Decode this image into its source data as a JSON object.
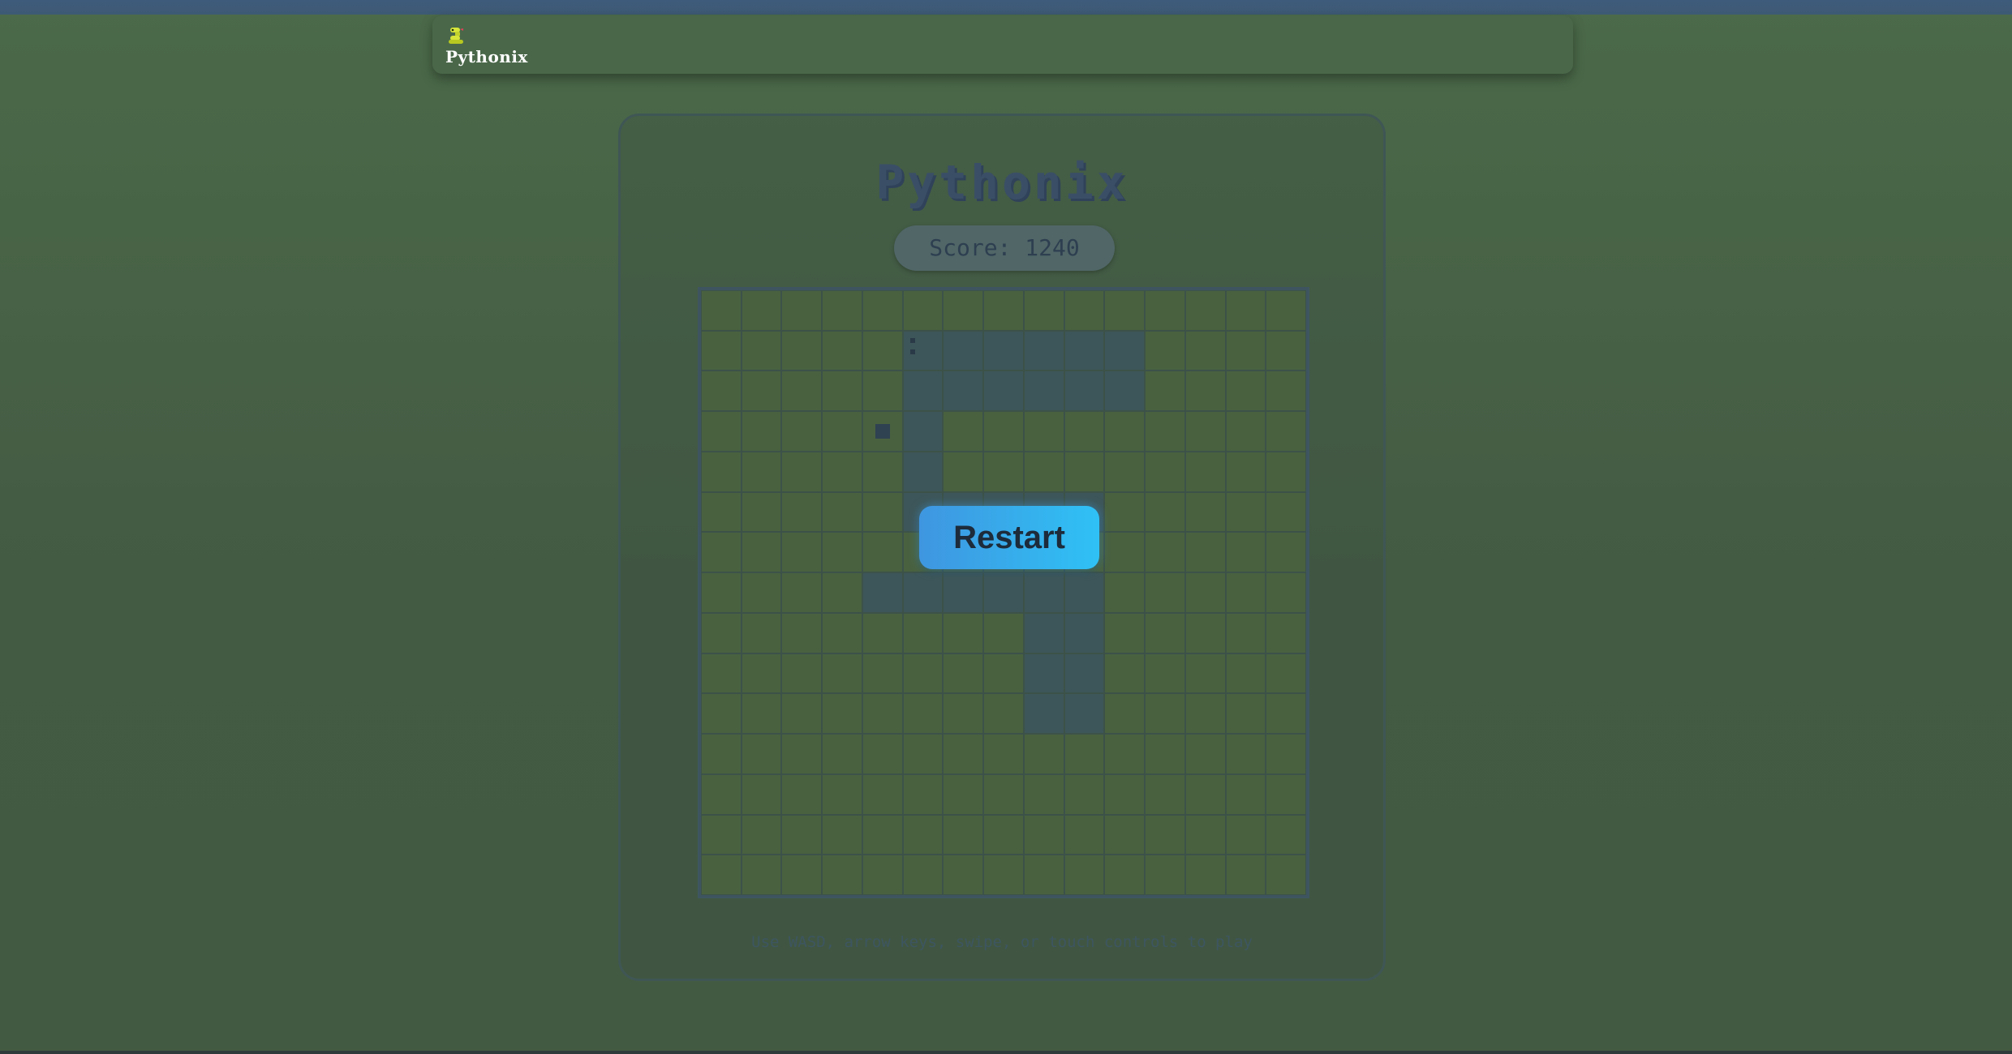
{
  "app": {
    "name": "Pythonix",
    "logo_icon": "snake-icon"
  },
  "game": {
    "title": "Pythonix",
    "score_label": "Score:",
    "score": "1240",
    "restart_label": "Restart",
    "instructions": "Use WASD, arrow keys, swipe, or touch controls to play",
    "board": {
      "columns": 15,
      "rows": 15,
      "snake_head": [
        5,
        1
      ],
      "snake_cells": [
        [
          5,
          1
        ],
        [
          6,
          1
        ],
        [
          7,
          1
        ],
        [
          8,
          1
        ],
        [
          9,
          1
        ],
        [
          10,
          1
        ],
        [
          5,
          2
        ],
        [
          6,
          2
        ],
        [
          7,
          2
        ],
        [
          8,
          2
        ],
        [
          9,
          2
        ],
        [
          10,
          2
        ],
        [
          5,
          3
        ],
        [
          5,
          4
        ],
        [
          5,
          5
        ],
        [
          6,
          5
        ],
        [
          7,
          5
        ],
        [
          8,
          5
        ],
        [
          9,
          5
        ],
        [
          4,
          7
        ],
        [
          5,
          7
        ],
        [
          6,
          7
        ],
        [
          7,
          7
        ],
        [
          8,
          7
        ],
        [
          9,
          7
        ],
        [
          8,
          8
        ],
        [
          9,
          8
        ],
        [
          8,
          9
        ],
        [
          9,
          9
        ],
        [
          8,
          10
        ],
        [
          9,
          10
        ]
      ],
      "food": [
        4,
        3
      ]
    }
  },
  "colors": {
    "accent_button_start": "#3f96e0",
    "accent_button_end": "#2fc1f6",
    "background": "#4b6a49",
    "snake": "#3d5659"
  }
}
